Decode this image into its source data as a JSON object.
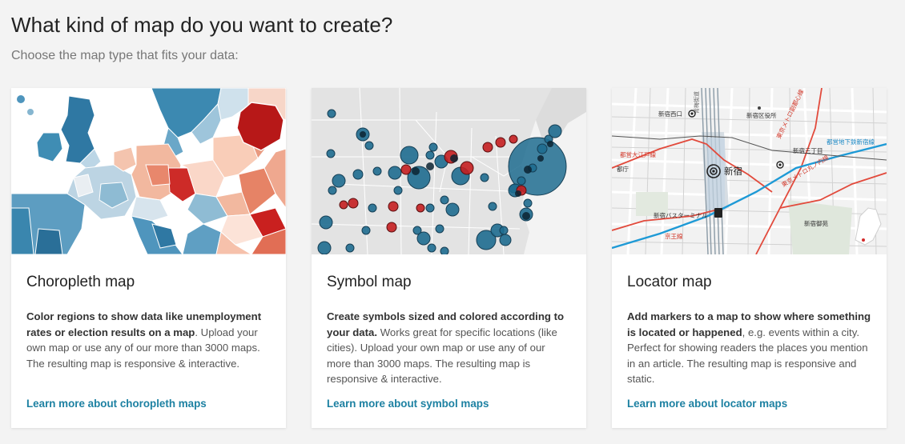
{
  "page": {
    "title": "What kind of map do you want to create?",
    "subtitle": "Choose the map type that fits your data:"
  },
  "colors": {
    "link": "#1d81a2",
    "blue_dark": "#1f6f94",
    "red_dark": "#b41a1a",
    "background": "#f3f3f3"
  },
  "cards": [
    {
      "id": "choropleth",
      "thumbnail_icon": "choropleth-europe-map",
      "title": "Choropleth map",
      "desc_bold": "Color regions to show data like unemployment rates or election results on a map",
      "desc_rest": ". Upload your own map or use any of our more than 3000 maps. The resulting map is responsive & interactive.",
      "link": "Learn more about choropleth maps"
    },
    {
      "id": "symbol",
      "thumbnail_icon": "symbol-usa-map",
      "title": "Symbol map",
      "desc_bold": "Create symbols sized and colored according to your data.",
      "desc_rest": " Works great for specific locations (like cities). Upload your own map or use any of our more than 3000 maps. The resulting map is responsive & interactive.",
      "link": "Learn more about symbol maps"
    },
    {
      "id": "locator",
      "thumbnail_icon": "locator-city-map",
      "title": "Locator map",
      "desc_bold": "Add markers to a map to show where something is located or happened",
      "desc_rest": ", e.g. events within a city. Perfect for showing readers the places you mention in an article. The resulting map is responsive and static.",
      "link": "Learn more about locator maps",
      "map_labels": {
        "station": "新宿",
        "nishi": "新宿西口",
        "ward": "新宿区役所",
        "sanchome": "新宿三丁目",
        "bus": "新宿バスターミナル",
        "gyoen": "新宿御苑",
        "oedo": "都営大江戸線",
        "keio": "京王線",
        "marunouchi": "東京メトロ丸ノ内線",
        "fukutoshin": "東京メトロ副都心線",
        "shinjuku_line": "都営地下鉄新宿線",
        "tocho": "都庁",
        "ome": "青梅街道"
      }
    }
  ]
}
